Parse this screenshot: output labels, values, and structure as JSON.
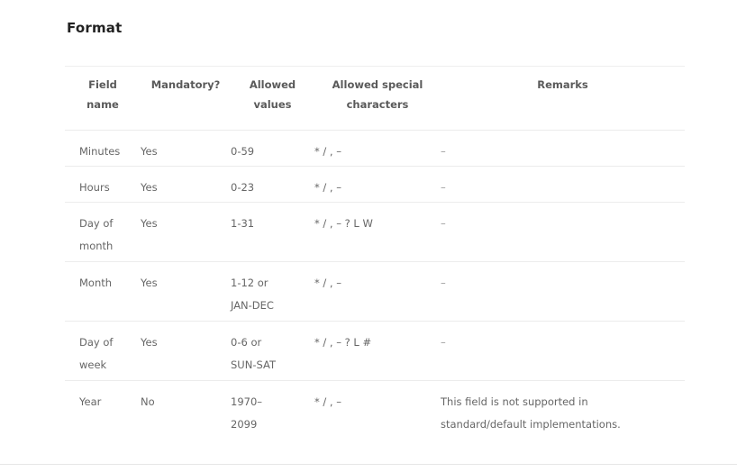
{
  "section": {
    "title": "Format"
  },
  "table": {
    "headers": [
      "Field\nname",
      "Mandatory?",
      "Allowed\nvalues",
      "Allowed special\ncharacters",
      "Remarks"
    ],
    "rows": [
      [
        "Minutes",
        "Yes",
        "0-59",
        "* / , –",
        "–"
      ],
      [
        "Hours",
        "Yes",
        "0-23",
        "* / , –",
        "–"
      ],
      [
        "Day of\nmonth",
        "Yes",
        "1-31",
        "* / , – ? L W",
        "–"
      ],
      [
        "Month",
        "Yes",
        "1-12 or\nJAN-DEC",
        "* / , –",
        "–"
      ],
      [
        "Day of\nweek",
        "Yes",
        "0-6 or\nSUN-SAT",
        "* / , – ? L #",
        "–"
      ],
      [
        "Year",
        "No",
        "1970–\n2099",
        "* / , –",
        "This field is not supported in\nstandard/default implementations."
      ]
    ]
  }
}
